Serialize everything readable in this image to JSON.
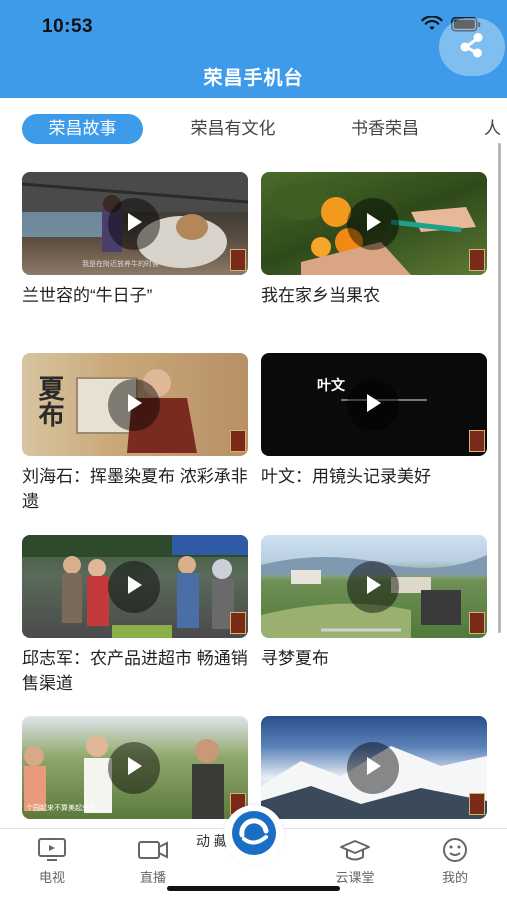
{
  "status": {
    "time": "10:53"
  },
  "header": {
    "title": "荣昌手机台"
  },
  "tabs": [
    {
      "label": "荣昌故事",
      "active": true
    },
    {
      "label": "荣昌有文化",
      "active": false
    },
    {
      "label": "书香荣昌",
      "active": false
    },
    {
      "label": "人",
      "active": false
    }
  ],
  "videos": [
    {
      "title": "兰世容的“牛日子”",
      "caption": "我是在附近放养牛的时候"
    },
    {
      "title": "我在家乡当果农",
      "caption": ""
    },
    {
      "title": "刘海石：挥墨染夏布 浓彩承非遗",
      "caption": "",
      "overlay": "夏布"
    },
    {
      "title": "叶文：用镜头记录美好",
      "caption": "",
      "overlay": "叶文"
    },
    {
      "title": "邱志军：农产品进超市 畅通销售渠道",
      "caption": ""
    },
    {
      "title": "寻梦夏布",
      "caption": ""
    },
    {
      "title": "",
      "caption": "个园起来不算美起来舍"
    },
    {
      "title": "",
      "caption": ""
    }
  ],
  "bottom_nav": {
    "items": [
      {
        "label": "电视",
        "icon": "tv-icon"
      },
      {
        "label": "直播",
        "icon": "video-camera-icon"
      },
      {
        "label": "云课堂",
        "icon": "graduation-cap-icon"
      },
      {
        "label": "我的",
        "icon": "smile-face-icon"
      }
    ],
    "center_text": "动 藏"
  },
  "colors": {
    "accent": "#3d9be9"
  }
}
